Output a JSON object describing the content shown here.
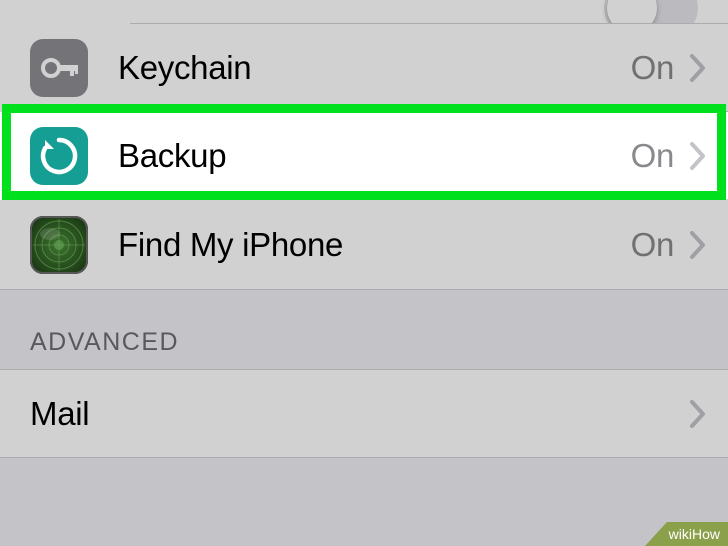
{
  "rows": {
    "keychain": {
      "label": "Keychain",
      "status": "On"
    },
    "backup": {
      "label": "Backup",
      "status": "On"
    },
    "findmy": {
      "label": "Find My iPhone",
      "status": "On"
    },
    "mail": {
      "label": "Mail"
    }
  },
  "section": {
    "advanced": "ADVANCED"
  },
  "watermark": "wikiHow",
  "colors": {
    "highlight": "#00e01c",
    "backup_icon": "#159f94",
    "keychain_icon": "#8e8e93"
  }
}
